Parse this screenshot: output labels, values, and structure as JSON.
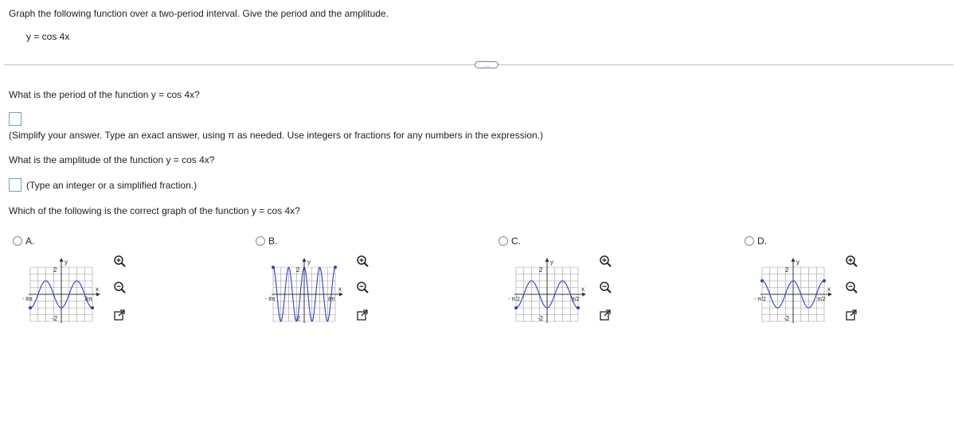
{
  "question": {
    "instruction": "Graph the following function over a two-period interval. Give the period and the amplitude.",
    "function": "y = cos 4x"
  },
  "separator": {
    "button_label": "..."
  },
  "period": {
    "question": "What is the period of the function y = cos 4x?",
    "answer_value": "",
    "hint": "(Simplify your answer. Type an exact answer, using π as needed. Use integers or fractions for any numbers in the expression.)"
  },
  "amplitude": {
    "question": "What is the amplitude of the function y = cos 4x?",
    "answer_value": "",
    "hint": "(Type an integer or a simplified fraction.)"
  },
  "graph_question": "Which of the following is the correct graph of the function y = cos 4x?",
  "options": [
    {
      "label": "A.",
      "y_tick": "2",
      "neg_tick": "-2",
      "x_left": "- 8π",
      "x_right": "8π",
      "axis_x": "x",
      "axis_y": "y"
    },
    {
      "label": "B.",
      "y_tick": "2",
      "neg_tick": "-2",
      "x_left": "- 8π",
      "x_right": "8π",
      "axis_x": "x",
      "axis_y": "y"
    },
    {
      "label": "C.",
      "y_tick": "2",
      "neg_tick": "-2",
      "x_left": "- π/2",
      "x_right": "π/2",
      "axis_x": "x",
      "axis_y": "y"
    },
    {
      "label": "D.",
      "y_tick": "2",
      "neg_tick": "-2",
      "x_left": "- π/2",
      "x_right": "π/2",
      "axis_x": "x",
      "axis_y": "y"
    }
  ],
  "colors": {
    "curve": "#2a3fcf",
    "grid": "#9a9a9a",
    "icon": "#222222"
  }
}
